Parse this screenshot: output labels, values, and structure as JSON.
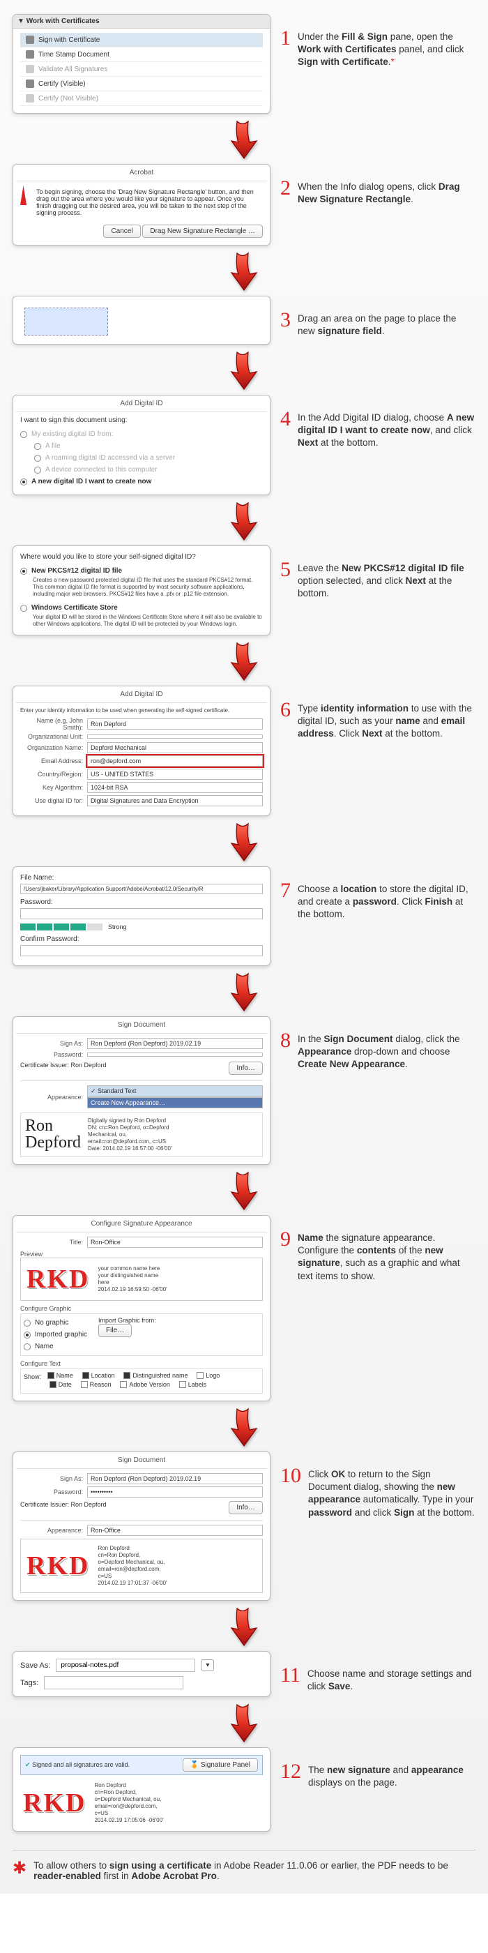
{
  "steps": {
    "s1": {
      "num": "1",
      "desc": "Under the <b>Fill & Sign</b> pane, open the <b>Work with Certificates</b> panel, and click <b>Sign with Certificate</b>.<span style='color:#d22'>*</span>"
    },
    "s2": {
      "num": "2",
      "desc": "When the Info dialog opens, click <b>Drag New Signature Rectangle</b>."
    },
    "s3": {
      "num": "3",
      "desc": "Drag an area on the page to place the new <b>signature field</b>."
    },
    "s4": {
      "num": "4",
      "desc": "In the Add Digital ID dialog, choose <b>A new digital ID I want to create now</b>, and click <b>Next</b> at the bottom."
    },
    "s5": {
      "num": "5",
      "desc": "Leave the <b>New PKCS#12 digital ID file</b> option selected, and click <b>Next</b> at the bottom."
    },
    "s6": {
      "num": "6",
      "desc": "Type <b>identity information</b> to use with the digital ID, such as your <b>name</b> and <b>email address</b>. Click <b>Next</b> at the bottom."
    },
    "s7": {
      "num": "7",
      "desc": "Choose a <b>location</b> to store the digital ID, and create a <b>password</b>. Click <b>Finish</b> at the bottom."
    },
    "s8": {
      "num": "8",
      "desc": "In the <b>Sign Document</b> dialog, click the <b>Appearance</b> drop-down and choose <b>Create New Appearance</b>."
    },
    "s9": {
      "num": "9",
      "desc": "<b>Name</b> the signature appearance. Configure the <b>contents</b> of the <b>new signature</b>, such as a graphic and what text items to show."
    },
    "s10": {
      "num": "10",
      "desc": "Click <b>OK</b> to return to the Sign Document dialog, showing the <b>new appearance</b> automatically. Type in your <b>password</b> and click <b>Sign</b> at the bottom."
    },
    "s11": {
      "num": "11",
      "desc": "Choose name and storage settings and click <b>Save</b>."
    },
    "s12": {
      "num": "12",
      "desc": "The <b>new signature</b> and <b>appearance</b> displays on the page."
    }
  },
  "shot1": {
    "title": "Work with Certificates",
    "items": [
      "Sign with Certificate",
      "Time Stamp Document",
      "Validate All Signatures",
      "Certify (Visible)",
      "Certify (Not Visible)"
    ]
  },
  "shot2": {
    "title": "Acrobat",
    "body": "To begin signing, choose the 'Drag New Signature Rectangle' button, and then drag out the area where you would like your signature to appear. Once you finish dragging out the desired area, you will be taken to the next step of the signing process.",
    "btn_cancel": "Cancel",
    "btn_drag": "Drag New Signature Rectangle …"
  },
  "shot4": {
    "title": "Add Digital ID",
    "lead": "I want to sign this document using:",
    "opts": [
      "My existing digital ID from:",
      "A file",
      "A roaming digital ID accessed via a server",
      "A device connected to this computer",
      "A new digital ID I want to create now"
    ]
  },
  "shot5": {
    "lead": "Where would you like to store your self-signed digital ID?",
    "opt1_t": "New PKCS#12 digital ID file",
    "opt1_b": "Creates a new password protected digital ID file that uses the standard PKCS#12 format. This common digital ID file format is supported by most security software applications, including major web browsers. PKCS#12 files have a .pfx or .p12 file extension.",
    "opt2_t": "Windows Certificate Store",
    "opt2_b": "Your digital ID will be stored in the Windows Certificate Store where it will also be available to other Windows applications. The digital ID will be protected by your Windows login."
  },
  "shot6": {
    "title": "Add Digital ID",
    "lead": "Enter your identity information to be used when generating the self-signed certificate.",
    "name_l": "Name (e.g. John Smith):",
    "name_v": "Ron Depford",
    "org_l": "Organizational Unit:",
    "orgn_l": "Organization Name:",
    "orgn_v": "Depford Mechanical",
    "email_l": "Email Address:",
    "email_v": "ron@depford.com",
    "ctry_l": "Country/Region:",
    "ctry_v": "US - UNITED STATES",
    "alg_l": "Key Algorithm:",
    "alg_v": "1024-bit RSA",
    "use_l": "Use digital ID for:",
    "use_v": "Digital Signatures and Data Encryption"
  },
  "shot7": {
    "file_l": "File Name:",
    "file_v": "/Users/jbaker/Library/Application Support/Adobe/Acrobat/12.0/Security/R",
    "pwd_l": "Password:",
    "strength": "Strong",
    "conf_l": "Confirm Password:"
  },
  "shot8": {
    "title": "Sign Document",
    "sign_l": "Sign As:",
    "sign_v": "Ron Depford (Ron Depford) 2019.02.19",
    "pwd_l": "Password:",
    "issuer_l": "Certificate Issuer: Ron Depford",
    "info": "Info…",
    "app_l": "Appearance:",
    "app_v": "Standard Text",
    "app_new": "Create New Appearance…",
    "name_big": "Ron\nDepford",
    "dn": "Digitally signed by Ron Depford\nDN: cn=Ron Depford, o=Depford\nMechanical, ou,\nemail=ron@depford.com, c=US\nDate: 2014.02.19 16:57:00 -06'00'"
  },
  "shot9": {
    "title": "Configure Signature Appearance",
    "title_l": "Title:",
    "title_v": "Ron-Office",
    "preview_l": "Preview",
    "rkd": "RKD",
    "ptxt": "your common name here\nyour distinguished name\nhere\n2014.02.19 16:59:50 -06'00'",
    "cg": "Configure Graphic",
    "show_l": "Show:",
    "go1": "No graphic",
    "go2": "Imported graphic",
    "go3": "Name",
    "imp_l": "Import Graphic from:",
    "imp_btn": "File…",
    "ct": "Configure Text",
    "tx_name": "Name",
    "tx_loc": "Location",
    "tx_dn": "Distinguished name",
    "tx_logo": "Logo",
    "tx_date": "Date",
    "tx_reason": "Reason",
    "tx_av": "Adobe Version",
    "tx_lbl": "Labels"
  },
  "shot10": {
    "title": "Sign Document",
    "sign_l": "Sign As:",
    "sign_v": "Ron Depford (Ron Depford) 2019.02.19",
    "pwd_l": "Password:",
    "pwd_v": "••••••••••",
    "issuer_l": "Certificate Issuer: Ron Depford",
    "info": "Info…",
    "app_l": "Appearance:",
    "app_v": "Ron-Office",
    "rkd": "RKD",
    "dn": "Ron Depford\ncn=Ron Depford,\no=Depford Mechanical, ou,\nemail=ron@depford.com,\nc=US\n2014.02.19 17:01:37 -06'00'"
  },
  "shot11": {
    "save_l": "Save As:",
    "save_v": "proposal-notes.pdf",
    "tags_l": "Tags:"
  },
  "shot12": {
    "bar": "Signed and all signatures are valid.",
    "panel": "Signature Panel",
    "rkd": "RKD",
    "dn": "Ron Depford\ncn=Ron Depford,\no=Depford Mechanical, ou,\nemail=ron@depford.com,\nc=US\n2014.02.19 17:05:06 -06'00'"
  },
  "footnote": "To allow others to <b>sign using a certificate</b> in Adobe Reader 11.0.06 or earlier, the PDF needs to be <b>reader-enabled</b> first in <b>Adobe Acrobat Pro</b>."
}
